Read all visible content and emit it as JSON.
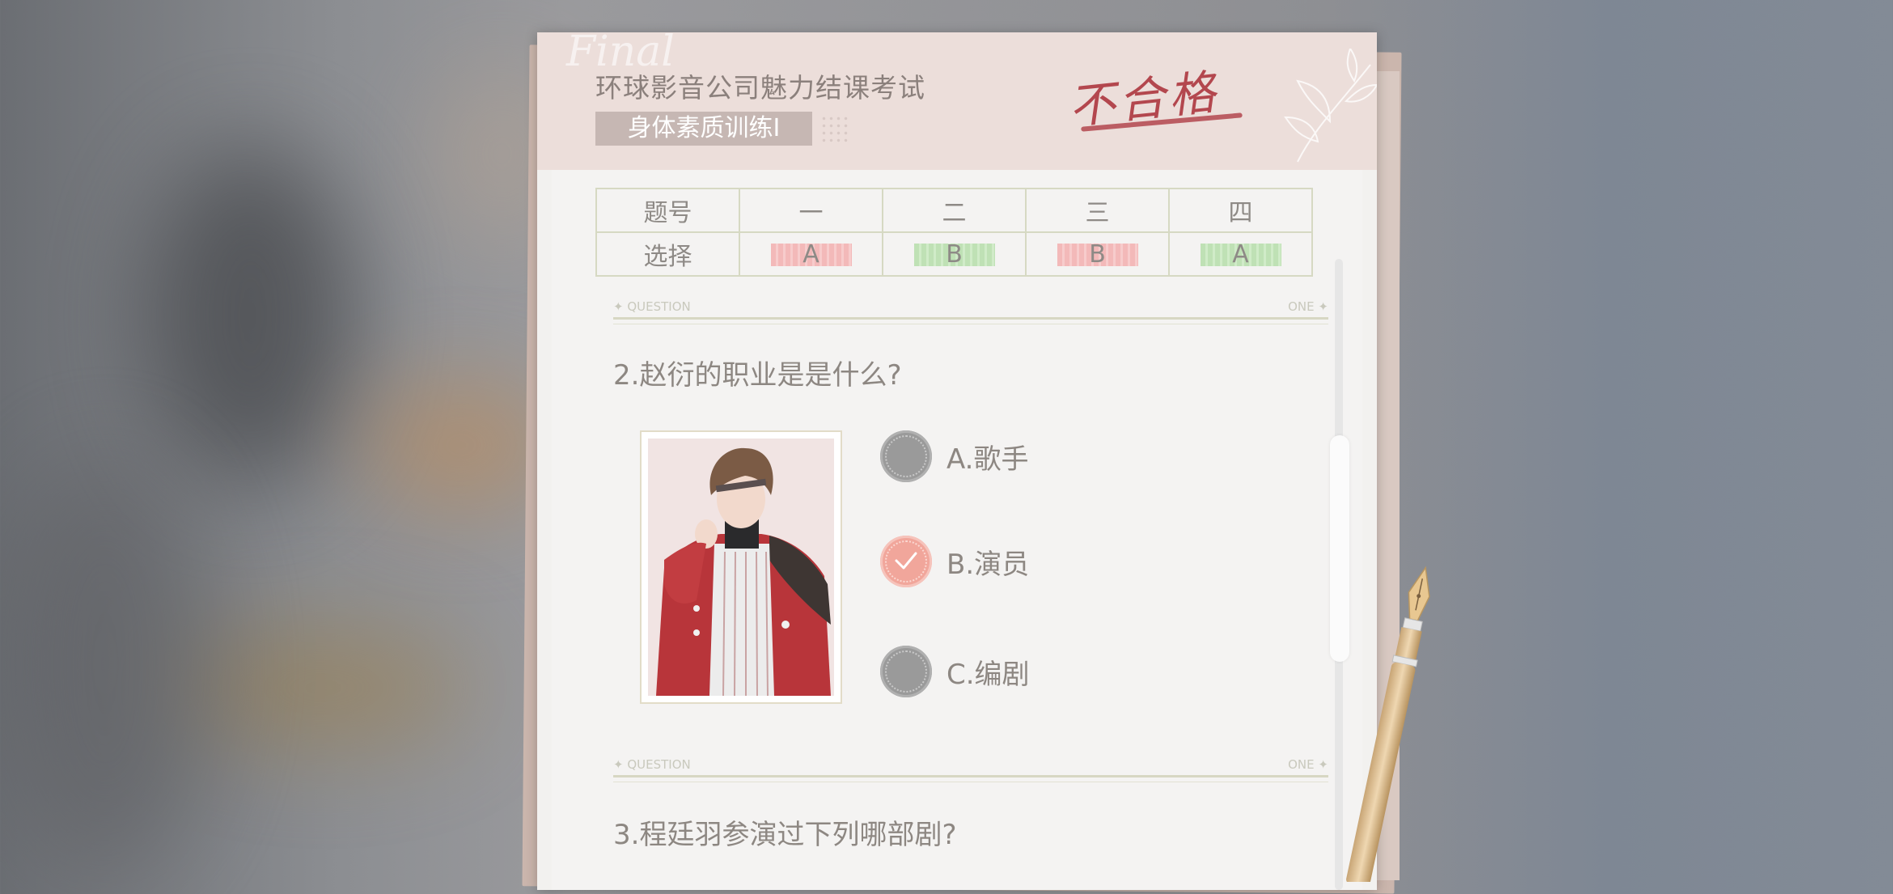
{
  "exam": {
    "title": "环球影音公司魅力结课考试",
    "subtitle": "身体素质训练Ⅰ",
    "result_stamp": "不合格",
    "deco_script": "Final"
  },
  "answer_table": {
    "row_labels": [
      "题号",
      "选择"
    ],
    "columns": [
      "一",
      "二",
      "三",
      "四"
    ],
    "answers": [
      {
        "value": "A",
        "status": "wrong"
      },
      {
        "value": "B",
        "status": "correct"
      },
      {
        "value": "B",
        "status": "wrong"
      },
      {
        "value": "A",
        "status": "correct"
      }
    ]
  },
  "section_header": {
    "left": "QUESTION",
    "right": "ONE"
  },
  "questions": [
    {
      "text": "2.赵衍的职业是是什么?",
      "options": [
        {
          "label": "A.歌手",
          "selected": false
        },
        {
          "label": "B.演员",
          "selected": true
        },
        {
          "label": "C.编剧",
          "selected": false
        }
      ]
    },
    {
      "text": "3.程廷羽参演过下列哪部剧?"
    }
  ],
  "colors": {
    "stamp": "#b3474e",
    "selected": "#f1a69b",
    "wrong_mark": "#f3b9b9",
    "correct_mark": "#bfe1b5"
  }
}
